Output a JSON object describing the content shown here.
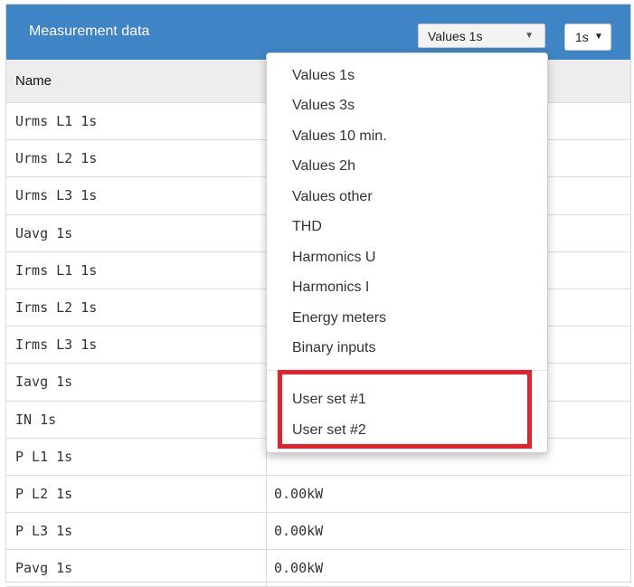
{
  "panel": {
    "title": "Measurement data",
    "select_value": "Values 1s",
    "period_value": "1s",
    "accent_color": "#3f84c4",
    "highlight_color": "#e8202a"
  },
  "table": {
    "header": {
      "name": "Name"
    },
    "rows": [
      {
        "name": "Urms L1 1s",
        "value": ""
      },
      {
        "name": "Urms L2 1s",
        "value": ""
      },
      {
        "name": "Urms L3 1s",
        "value": ""
      },
      {
        "name": "Uavg 1s",
        "value": ""
      },
      {
        "name": "Irms L1 1s",
        "value": ""
      },
      {
        "name": "Irms L2 1s",
        "value": ""
      },
      {
        "name": "Irms L3 1s",
        "value": ""
      },
      {
        "name": "Iavg 1s",
        "value": ""
      },
      {
        "name": "IN 1s",
        "value": ""
      },
      {
        "name": "P L1 1s",
        "value": ""
      },
      {
        "name": "P L2 1s",
        "value": "0.00kW"
      },
      {
        "name": "P L3 1s",
        "value": "0.00kW"
      },
      {
        "name": "Pavg 1s",
        "value": "0.00kW"
      }
    ]
  },
  "dropdown": {
    "items": [
      "Values 1s",
      "Values 3s",
      "Values 10 min.",
      "Values 2h",
      "Values other",
      "THD",
      "Harmonics U",
      "Harmonics I",
      "Energy meters",
      "Binary inputs"
    ],
    "user_items": [
      "User set #1",
      "User set #2"
    ]
  },
  "icons": {
    "caret": "caret-down-icon"
  }
}
